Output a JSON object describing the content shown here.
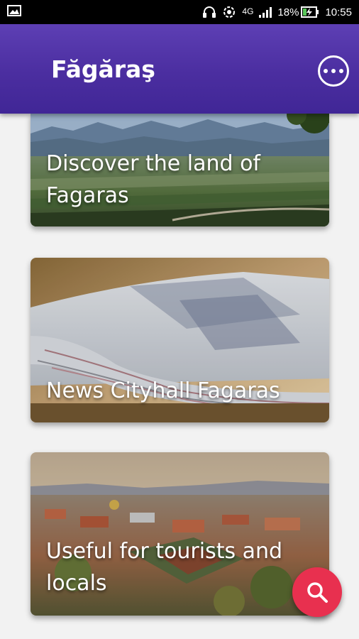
{
  "status_bar": {
    "network": "4G",
    "battery": "18%",
    "time": "10:55"
  },
  "app_bar": {
    "title": "Făgăraş"
  },
  "cards": [
    {
      "title": "Discover the land of Fagaras"
    },
    {
      "title": "News Cityhall Fagaras"
    },
    {
      "title": "Useful for tourists and locals"
    }
  ],
  "colors": {
    "app_bar": "#4b2ea0",
    "fab": "#e8304f"
  },
  "icons": {
    "more": "more-horizontal-icon",
    "search": "search-icon"
  }
}
